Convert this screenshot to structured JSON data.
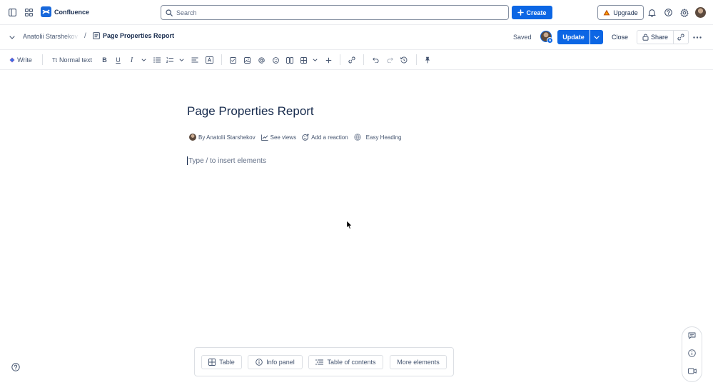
{
  "topnav": {
    "app_name": "Confluence",
    "search_placeholder": "Search",
    "create_label": "Create",
    "upgrade_label": "Upgrade"
  },
  "page_header": {
    "breadcrumb_space": "Anatolii Starshekov",
    "breadcrumb_separator": "/",
    "breadcrumb_page": "Page Properties Report",
    "saved_label": "Saved",
    "avatar_badge": "A",
    "update_label": "Update",
    "close_label": "Close",
    "share_label": "Share"
  },
  "toolbar": {
    "write_label": "Write",
    "text_style_prefix": "Tt",
    "text_style_label": "Normal text",
    "bold": "B",
    "underline": "U",
    "italic": "I"
  },
  "content": {
    "title": "Page Properties Report",
    "byline": {
      "author": "By Anatolii Starshekov",
      "see_views": "See views",
      "add_reaction": "Add a reaction",
      "app_label": "Easy Heading"
    },
    "placeholder": "Type / to insert elements"
  },
  "insert_bar": {
    "table": "Table",
    "info_panel": "Info panel",
    "table_of_contents": "Table of contents",
    "more_elements": "More elements"
  },
  "colors": {
    "brand_blue": "#0c66e4",
    "text_primary": "#172b4d",
    "text_subtle": "#44546f",
    "border": "#dcdfe4"
  }
}
